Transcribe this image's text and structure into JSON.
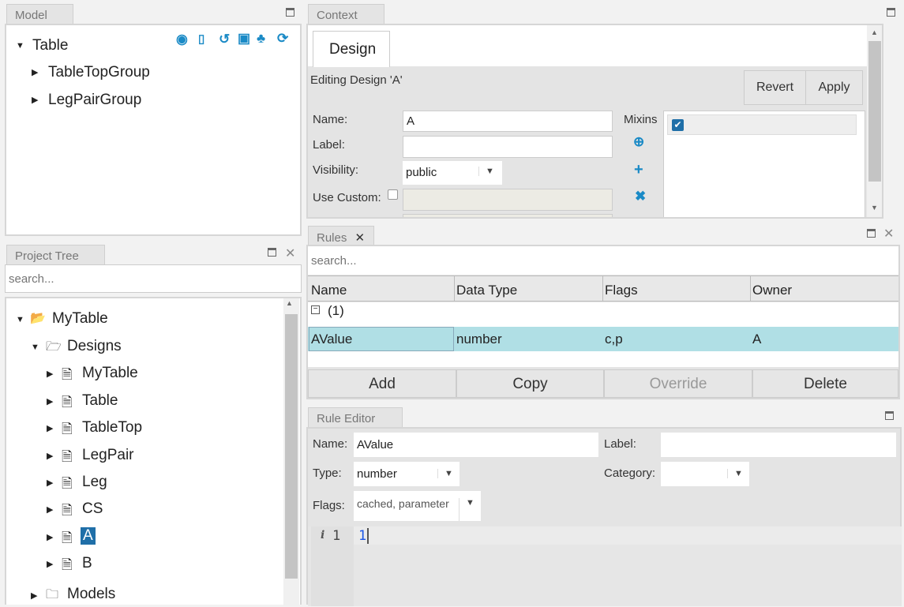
{
  "model": {
    "tab": "Model",
    "root": "Table",
    "children": [
      "TableTopGroup",
      "LegPairGroup"
    ],
    "toolbar_icons": [
      "user-circle-icon",
      "code-file-icon",
      "history-icon",
      "save-icon",
      "sitemap-icon",
      "refresh-icon"
    ]
  },
  "context": {
    "tab": "Context",
    "design_tab": "Design",
    "editing": "Editing Design 'A'",
    "revert": "Revert",
    "apply": "Apply",
    "name_label": "Name:",
    "name_value": "A",
    "label_label": "Label:",
    "label_value": "",
    "visibility_label": "Visibility:",
    "visibility_value": "public",
    "use_custom_label": "Use Custom:",
    "mixins_label": "Mixins"
  },
  "project_tree": {
    "tab": "Project Tree",
    "search_placeholder": "search...",
    "root": "MyTable",
    "designs": "Designs",
    "items": [
      "MyTable",
      "Table",
      "TableTop",
      "LegPair",
      "Leg",
      "CS",
      "A",
      "B"
    ],
    "selected": "A",
    "models": "Models"
  },
  "rules": {
    "tab": "Rules",
    "search_placeholder": "search...",
    "columns": [
      "Name",
      "Data Type",
      "Flags",
      "Owner"
    ],
    "group": "(1)",
    "rows": [
      {
        "name": "AValue",
        "type": "number",
        "flags": "c,p",
        "owner": "A"
      }
    ],
    "add": "Add",
    "copy": "Copy",
    "override": "Override",
    "delete": "Delete"
  },
  "rule_editor": {
    "tab": "Rule Editor",
    "name_label": "Name:",
    "name_value": "AValue",
    "label_label": "Label:",
    "label_value": "",
    "type_label": "Type:",
    "type_value": "number",
    "category_label": "Category:",
    "category_value": "",
    "flags_label": "Flags:",
    "flags_value": "cached, parameter",
    "gutter_icon": "i",
    "line_number": "1",
    "code": "1"
  },
  "colors": {
    "accent": "#1a8ac6",
    "selected_row": "#b0dfe5",
    "selected_tree": "#1f6fa8"
  }
}
